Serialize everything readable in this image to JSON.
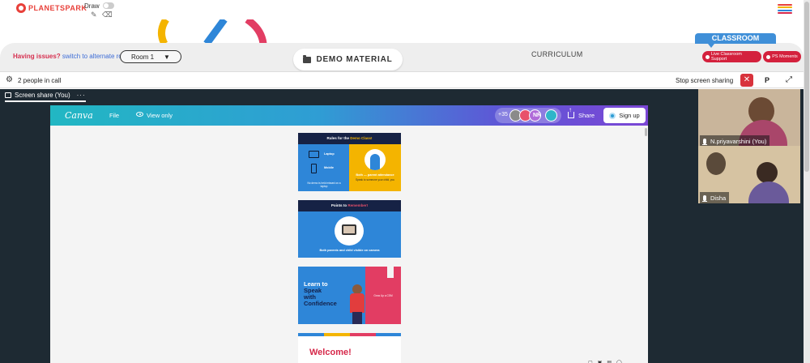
{
  "topbar": {
    "logo_text": "PLANETSPARK",
    "draw_label": "Draw",
    "menu_colors": [
      "#e8403a",
      "#f4b400",
      "#2e86d8",
      "#d6284a"
    ]
  },
  "header": {
    "issues_question": "Having issues?",
    "issues_link": "switch to alternate room",
    "room_value": "Room 1",
    "room_caret": "▼",
    "demo_material": "DEMO MATERIAL",
    "curriculum": "CURRICULUM",
    "classroom": "CLASSROOM",
    "live_support": "Live Classroom Support",
    "ps_moments": "PS Moments"
  },
  "callbar": {
    "people_text": "2 people in call",
    "stop_sharing": "Stop screen sharing",
    "close_glyph": "✕",
    "p_label": "P",
    "expand_glyph": "⤢"
  },
  "stage": {
    "share_tab": "Screen share (You)",
    "share_dots": "···"
  },
  "canva": {
    "logo": "Canva",
    "file": "File",
    "view_only": "View only",
    "avatar_count": "+35",
    "avatar_initials": "NR",
    "share": "Share",
    "signup": "Sign up",
    "accent": "#7b46d5"
  },
  "slides": {
    "s1_head_pre": "Rules for the",
    "s1_head_hl": "Demo Class!",
    "s1_laptop": "Laptop",
    "s1_mobile": "Mobile",
    "s1_note": "No demo is held missed on a laptop",
    "s1_right_title": "Both — parent attendance",
    "s1_right_note": "Speak to someone your child, you",
    "s2_head_pre": "Points to",
    "s2_head_hl": "Remember!",
    "s2_caption": "Both parents and child visible on camera",
    "s3_title_1": "Learn to",
    "s3_title_2": "Speak",
    "s3_title_3": "with",
    "s3_title_4": "Confidence",
    "s3_note": "Grow Up a CSM",
    "s4_title": "Welcome!",
    "s4_bar_colors": [
      "#2e86d8",
      "#f4b400",
      "#e23d63",
      "#2e86d8"
    ]
  },
  "participants": [
    {
      "name": "N.priyavarshini (You)"
    },
    {
      "name": "Disha"
    }
  ]
}
